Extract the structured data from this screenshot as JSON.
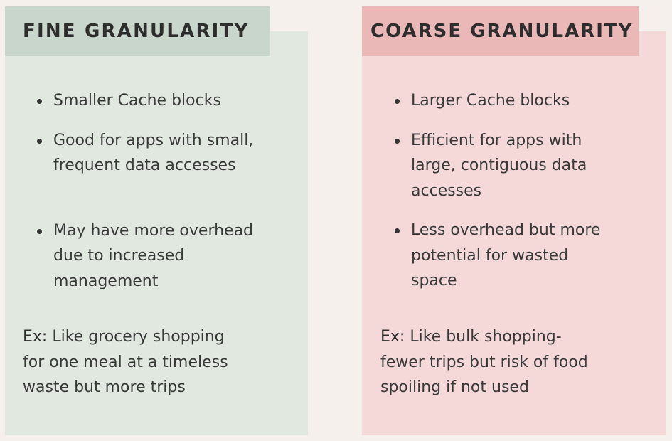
{
  "fine": {
    "title": "FINE GRANULARITY",
    "bullets": [
      {
        "lines": [
          "Smaller Cache blocks"
        ]
      },
      {
        "lines": [
          "Good for apps with small,",
          "frequent data accesses"
        ]
      },
      {
        "lines": [
          "May have more overhead",
          "due to increased",
          "management"
        ]
      }
    ],
    "example_label": "Ex:",
    "example_lines": [
      " Like grocery shopping",
      "for one meal at a timeless",
      "waste but more trips"
    ]
  },
  "coarse": {
    "title": "COARSE GRANULARITY",
    "bullets": [
      {
        "lines": [
          "Larger Cache blocks"
        ]
      },
      {
        "lines": [
          "Efficient for apps with",
          "large, contiguous data",
          "accesses"
        ]
      },
      {
        "lines": [
          "Less overhead but more",
          "potential for wasted",
          "space"
        ]
      }
    ],
    "example_label": "Ex:",
    "example_lines": [
      " Like bulk shopping-",
      "fewer trips but risk of food",
      "spoiling if not used"
    ]
  },
  "colors": {
    "background": "#f5f0eb",
    "fine_panel": "#e1e8e0",
    "fine_header": "#c9d6cc",
    "coarse_panel": "#f5d9d9",
    "coarse_header": "#ebb8b8"
  }
}
